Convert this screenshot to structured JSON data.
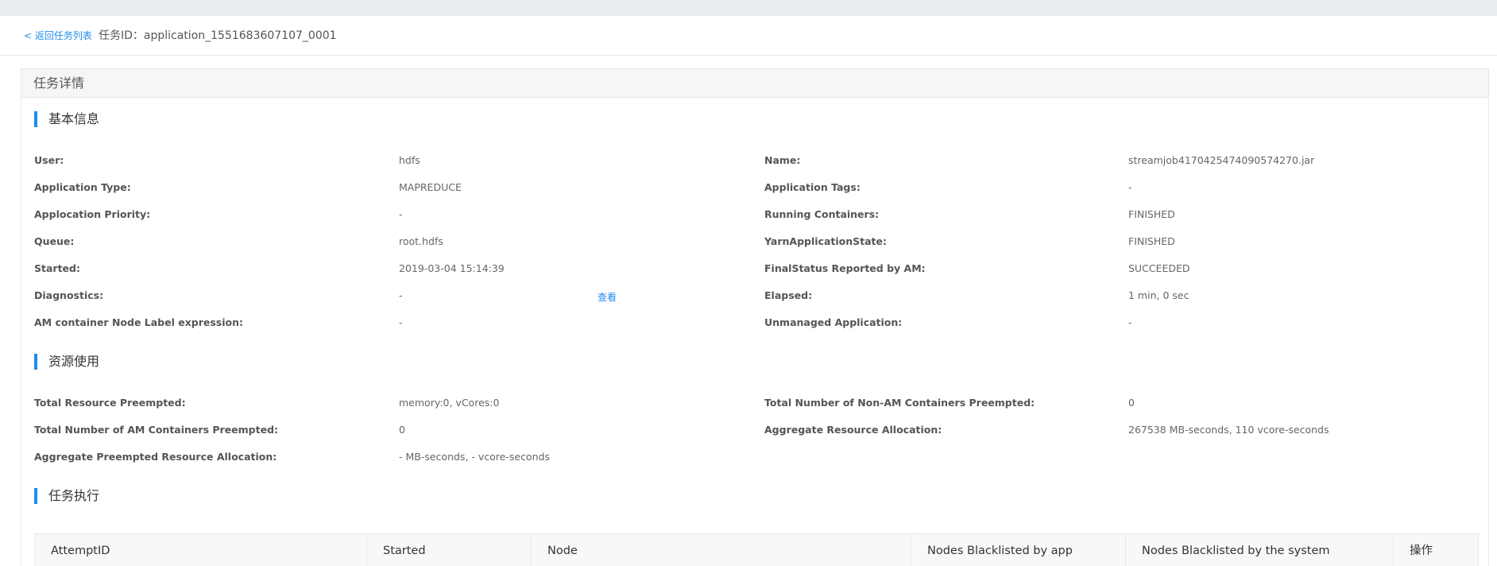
{
  "header": {
    "back_label": "< 返回任务列表",
    "task_id": "任务ID：application_1551683607107_0001"
  },
  "panel": {
    "title": "任务详情"
  },
  "basic": {
    "title": "基本信息",
    "view_label": "查看",
    "rows": [
      {
        "k1": "User:",
        "v1": "hdfs",
        "k2": "Name:",
        "v2": "streamjob4170425474090574270.jar"
      },
      {
        "k1": "Application Type:",
        "v1": "MAPREDUCE",
        "k2": "Application Tags:",
        "v2": "-"
      },
      {
        "k1": "Applocation Priority:",
        "v1": "-",
        "k2": "Running Containers:",
        "v2": "FINISHED"
      },
      {
        "k1": "Queue:",
        "v1": "root.hdfs",
        "k2": "YarnApplicationState:",
        "v2": "FINISHED"
      },
      {
        "k1": "Started:",
        "v1": "2019-03-04 15:14:39",
        "k2": "FinalStatus Reported by AM:",
        "v2": "SUCCEEDED"
      },
      {
        "k1": "Diagnostics:",
        "v1": "-",
        "k2": "Elapsed:",
        "v2": "1 min, 0 sec"
      },
      {
        "k1": "AM container Node Label expression:",
        "v1": "-",
        "k2": "Unmanaged Application:",
        "v2": "-"
      }
    ]
  },
  "resource": {
    "title": "资源使用",
    "rows": [
      {
        "k1": "Total Resource Preempted:",
        "v1": "memory:0, vCores:0",
        "k2": "Total Number of Non-AM Containers Preempted:",
        "v2": "0"
      },
      {
        "k1": "Total Number of AM Containers Preempted:",
        "v1": "0",
        "k2": "Aggregate Resource Allocation:",
        "v2": "267538 MB-seconds, 110 vcore-seconds"
      },
      {
        "k1": "Aggregate Preempted Resource Allocation:",
        "v1": "- MB-seconds, - vcore-seconds",
        "k2": "",
        "v2": ""
      }
    ]
  },
  "execution": {
    "title": "任务执行",
    "columns": [
      "AttemptID",
      "Started",
      "Node",
      "Nodes Blacklisted by app",
      "Nodes Blacklisted by the system",
      "操作"
    ]
  }
}
